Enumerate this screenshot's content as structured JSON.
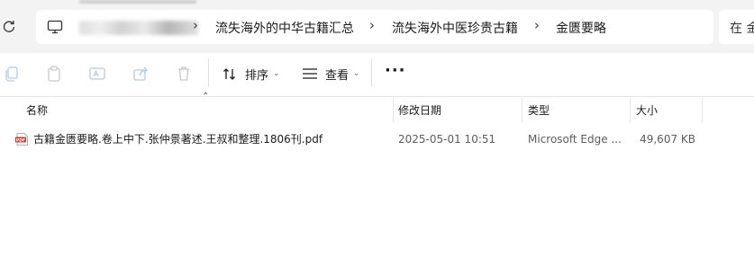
{
  "address_bar": {
    "breadcrumbs": [
      "流失海外的中华古籍汇总",
      "流失海外中医珍贵古籍",
      "金匮要略"
    ],
    "search_placeholder": "在 金"
  },
  "toolbar": {
    "sort_label": "排序",
    "view_label": "查看",
    "more_label": "···"
  },
  "columns": {
    "name": "名称",
    "modified": "修改日期",
    "type": "类型",
    "size": "大小"
  },
  "files": [
    {
      "name": "古籍金匮要略.卷上中下.张仲景著述.王叔和整理.1806刊.pdf",
      "modified": "2025-05-01 10:51",
      "type": "Microsoft Edge ...",
      "size": "49,607 KB",
      "icon": "pdf-icon"
    }
  ],
  "colors": {
    "address_bg": "#f3f3f3",
    "pdf_red": "#d1342f"
  }
}
